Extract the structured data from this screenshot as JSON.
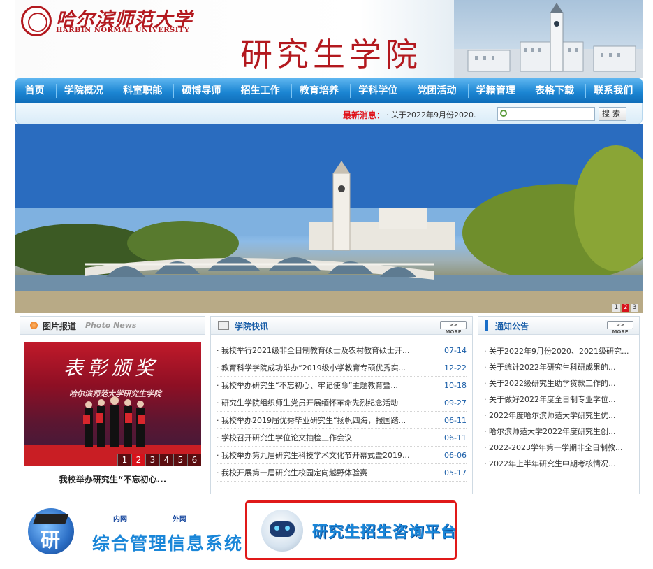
{
  "header": {
    "logo_cn": "哈尔滨师范大学",
    "logo_en": "HARBIN NORMAL UNIVERSITY",
    "site_title": "研究生学院"
  },
  "nav": {
    "items": [
      "首页",
      "学院概况",
      "科室职能",
      "硕博导师",
      "招生工作",
      "教育培养",
      "学科学位",
      "党团活动",
      "学籍管理",
      "表格下载",
      "联系我们"
    ]
  },
  "ticker": {
    "label": "最新消息：",
    "text": "· 关于2022年9月份2020."
  },
  "search": {
    "value": "",
    "button": "搜索"
  },
  "banner": {
    "pager": [
      "1",
      "2",
      "3"
    ],
    "active_index": 1
  },
  "photo_news": {
    "title": "图片报道",
    "subtitle": "Photo News",
    "banner_text": "表彰颁奖",
    "banner_subtext": "哈尔滨师范大学研究生学院",
    "pager": [
      "1",
      "2",
      "3",
      "4",
      "5",
      "6"
    ],
    "active_index": 1,
    "caption": "我校举办研究生“不忘初心..."
  },
  "college_news": {
    "title": "学院快讯",
    "more": "MORE",
    "items": [
      {
        "title": "· 我校举行2021级非全日制教育硕士及农村教育硕士开...",
        "date": "07-14"
      },
      {
        "title": "· 教育科学学院成功举办“2019级小学教育专硕优秀实...",
        "date": "12-22"
      },
      {
        "title": "· 我校举办研究生“不忘初心、牢记使命”主题教育暨...",
        "date": "10-18"
      },
      {
        "title": "· 研究生学院组织师生党员开展缅怀革命先烈纪念活动",
        "date": "09-27"
      },
      {
        "title": "· 我校举办2019届优秀毕业研究生“扬帆四海，报国踏...",
        "date": "06-11"
      },
      {
        "title": "· 学校召开研究生学位论文抽检工作会议",
        "date": "06-11"
      },
      {
        "title": "· 我校举办第九届研究生科技学术文化节开幕式暨2019...",
        "date": "06-06"
      },
      {
        "title": "· 我校开展第一届研究生校园定向越野体验赛",
        "date": "05-17"
      }
    ]
  },
  "notices": {
    "title": "通知公告",
    "more": "MORE",
    "items": [
      "· 关于2022年9月份2020、2021级研究...",
      "· 关于统计2022年研究生科研成果的...",
      "· 关于2022级研究生助学贷款工作的...",
      "· 关于做好2022年度全日制专业学位...",
      "· 2022年度哈尔滨师范大学研究生优...",
      "· 哈尔滨师范大学2022年度研究生创...",
      "· 2022-2023学年第一学期非全日制教...",
      "· 2022年上半年研究生中期考核情况..."
    ]
  },
  "bottom": {
    "cap_char": "研",
    "link_in": "内网",
    "link_out": "外网",
    "system_name": "综合管理信息系统",
    "consult_name": "研究生招生咨询平台"
  },
  "colors": {
    "brand_red": "#b3191f",
    "nav_blue": "#1c86d3",
    "alert_red": "#e0141c"
  }
}
